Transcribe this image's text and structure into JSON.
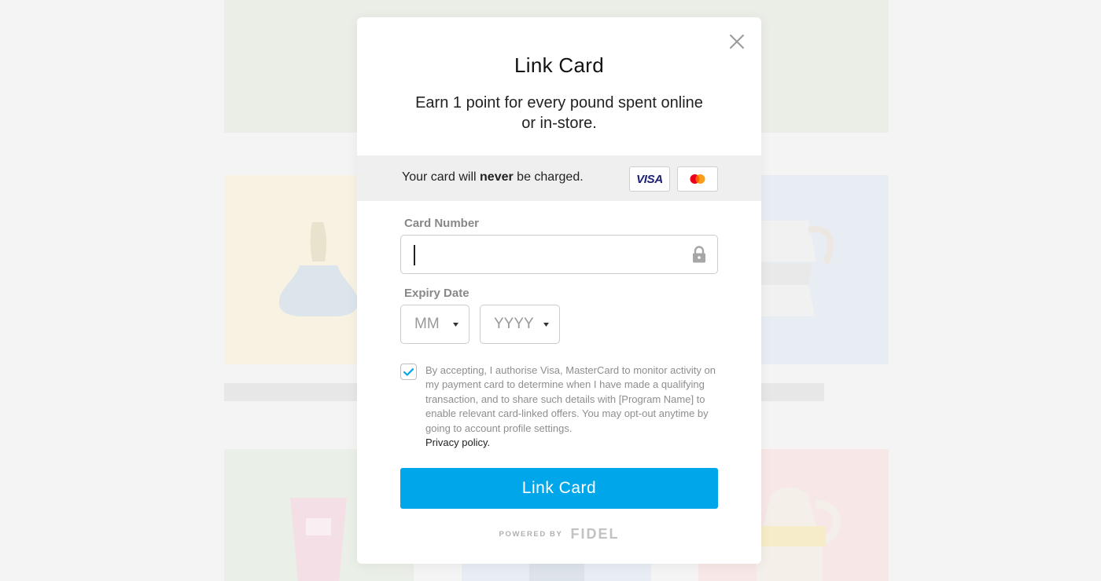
{
  "modal": {
    "title": "Link Card",
    "subtitle": "Earn 1 point for every pound spent online or in-store.",
    "notice": {
      "prefix": "Your card will ",
      "emphasis": "never",
      "suffix": " be charged."
    },
    "card_brands": [
      "VISA",
      "mastercard"
    ],
    "card_number": {
      "label": "Card Number",
      "value": "",
      "placeholder": ""
    },
    "expiry": {
      "label": "Expiry Date",
      "month_placeholder": "MM",
      "year_placeholder": "YYYY"
    },
    "consent": {
      "checked": true,
      "text": "By accepting, I authorise Visa, MasterCard to monitor activity on my payment card to determine when I have made a qualifying transaction, and to share such details with [Program Name] to enable relevant card-linked offers. You may opt-out anytime by going to account profile settings.",
      "privacy_link": "Privacy policy."
    },
    "submit_label": "Link Card",
    "powered_by": "POWERED BY",
    "provider": "FIDEL"
  },
  "colors": {
    "accent": "#00a6ea",
    "check": "#00a6ea",
    "visa": "#1a1f71",
    "mastercard_red": "#eb001b",
    "mastercard_orange": "#f79e1b"
  },
  "icons": {
    "close": "close-icon",
    "lock": "lock-icon",
    "dropdown": "caret-down-icon",
    "check": "checkmark-icon"
  }
}
